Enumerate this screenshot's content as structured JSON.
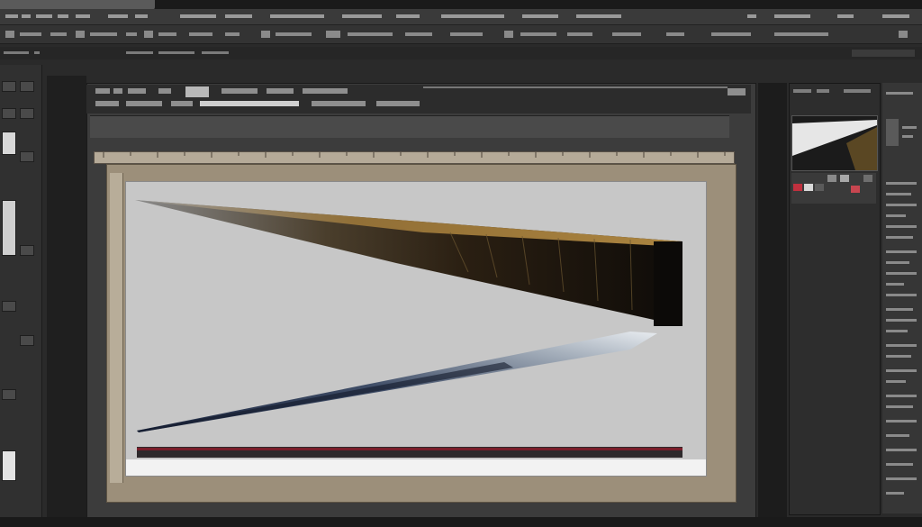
{
  "app": {
    "window_title": ""
  },
  "colors": {
    "ui_dark": "#2a2a2a",
    "canvas_background": "#c7c7c7",
    "pasteboard": "#9c8f7a",
    "dark_shape_gold": "#b48a3a",
    "dark_shape_black": "#1a1510",
    "steel_blade": "#4e5a6c",
    "stripe_red": "#7a1e2a"
  },
  "icons": {
    "tools": [
      "move-tool-icon",
      "marquee-tool-icon",
      "lasso-tool-icon",
      "crop-tool-icon",
      "brush-tool-icon",
      "eraser-tool-icon",
      "gradient-tool-icon",
      "pen-tool-icon",
      "text-tool-icon",
      "shape-tool-icon",
      "hand-tool-icon",
      "zoom-tool-icon"
    ]
  }
}
